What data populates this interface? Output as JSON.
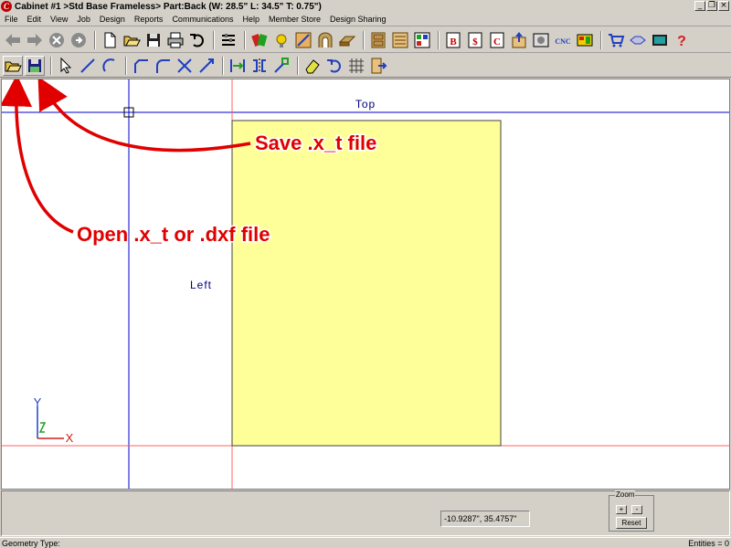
{
  "window": {
    "app_icon_letter": "C",
    "title": "Cabinet #1 >Std Base Frameless> Part:Back (W: 28.5\" L: 34.5\" T: 0.75\")",
    "minimize": "_",
    "restore": "❐",
    "close": "×"
  },
  "menu": [
    "File",
    "Edit",
    "View",
    "Job",
    "Design",
    "Reports",
    "Communications",
    "Help",
    "Member Store",
    "Design Sharing"
  ],
  "toolbar1": {
    "cnc_label": "CNC",
    "letter_b": "B",
    "letter_dollar": "$",
    "letter_c": "C",
    "help_mark": "?"
  },
  "canvas": {
    "top_label": "Top",
    "left_label": "Left",
    "axis_y": "Y",
    "axis_x": "X",
    "annotation_save": "Save .x_t file",
    "annotation_open": "Open .x_t or .dxf file"
  },
  "bottom": {
    "coordinates": "-10.9287\", 35.4757\"",
    "zoom_label": "Zoom",
    "zoom_in": "+",
    "zoom_out": "-",
    "reset": "Reset"
  },
  "status": {
    "geometry_type": "Geometry Type:",
    "entities": "Entities = 0"
  },
  "colors": {
    "part_fill": "#ffff99",
    "annotation_red": "#e00000",
    "guide_blue": "#0000cc",
    "guide_red": "#ff6060"
  }
}
